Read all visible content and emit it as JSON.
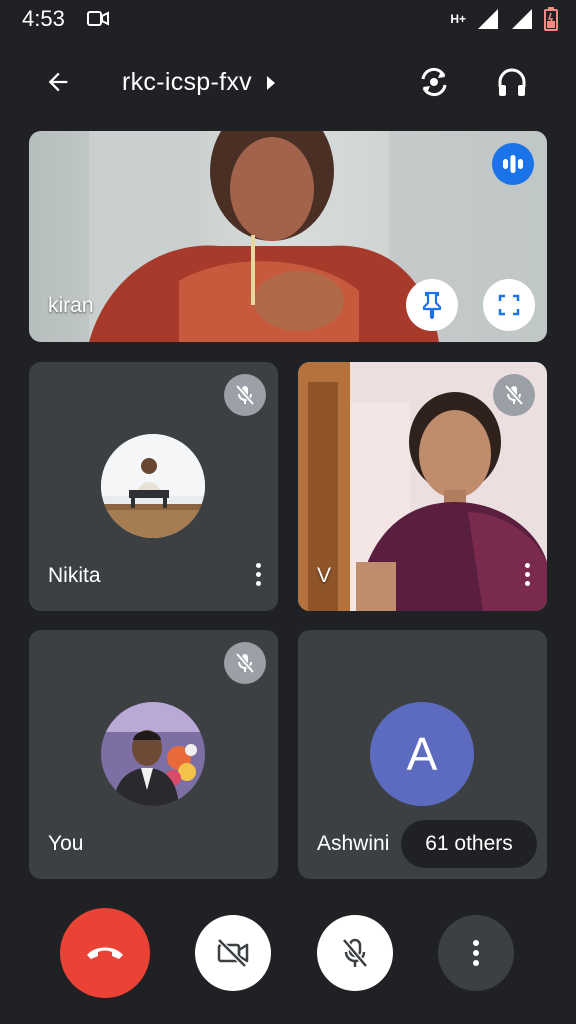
{
  "status_bar": {
    "time": "4:53",
    "network": "H+"
  },
  "top_bar": {
    "meeting_code": "rkc-icsp-fxv"
  },
  "tiles": {
    "featured": {
      "name": "kiran"
    },
    "nikita": {
      "name": "Nikita"
    },
    "v": {
      "name": "V"
    },
    "you": {
      "name": "You"
    },
    "ashwini": {
      "name": "Ashwini",
      "avatar_letter": "A",
      "others_label": "61 others"
    }
  },
  "colors": {
    "background": "#202124",
    "tile": "#3c4043",
    "end_call": "#ea4335",
    "avatar_a": "#5c6bc0",
    "speaking_badge": "#1a73e8"
  },
  "icons": [
    "back-arrow-icon",
    "chevron-right-icon",
    "switch-camera-icon",
    "headphones-icon",
    "speaking-indicator-icon",
    "pin-icon",
    "fullscreen-icon",
    "mic-off-icon",
    "more-vert-icon",
    "end-call-icon",
    "camera-off-icon"
  ]
}
